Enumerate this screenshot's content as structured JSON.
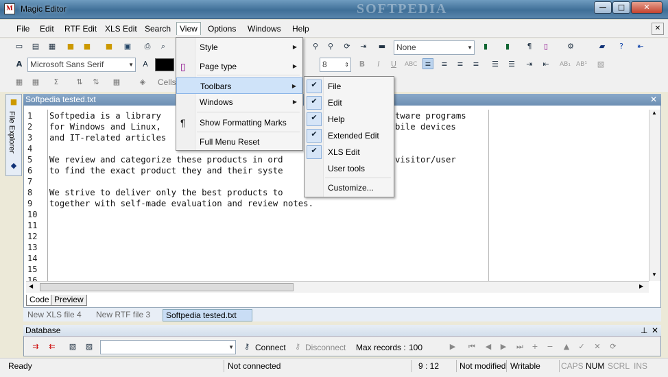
{
  "window": {
    "title": "Magic Editor",
    "watermark": "SOFTPEDIA",
    "min_btn": "—",
    "max_btn": "□",
    "close_btn": "✕"
  },
  "menubar": [
    "File",
    "Edit",
    "RTF Edit",
    "XLS Edit",
    "Search",
    "View",
    "Options",
    "Windows",
    "Help"
  ],
  "toolbar": {
    "style_combo": "None",
    "font_combo": "Microsoft Sans Serif",
    "size_combo": "8",
    "cells_label": "Cells"
  },
  "view_menu": [
    {
      "label": "Style",
      "has_sub": true,
      "icon": "",
      "highlight": false
    },
    {
      "label": "Page type",
      "has_sub": true,
      "icon": "page-icon",
      "highlight": false
    },
    {
      "label": "Toolbars",
      "has_sub": true,
      "icon": "",
      "highlight": true
    },
    {
      "label": "Windows",
      "has_sub": true,
      "icon": "",
      "highlight": false
    },
    {
      "label": "Show Formatting Marks",
      "has_sub": false,
      "icon": "pilcrow-icon",
      "highlight": false
    },
    {
      "label": "Full Menu Reset",
      "has_sub": false,
      "icon": "",
      "highlight": false
    }
  ],
  "toolbars_submenu": [
    {
      "label": "File",
      "checked": true
    },
    {
      "label": "Edit",
      "checked": true
    },
    {
      "label": "Help",
      "checked": true
    },
    {
      "label": "Extended Edit",
      "checked": true
    },
    {
      "label": "XLS Edit",
      "checked": true
    },
    {
      "label": "User tools",
      "checked": false
    },
    {
      "label": "Customize...",
      "checked": false
    }
  ],
  "sidebar": {
    "label": "File Explorer"
  },
  "document": {
    "title": "Softpedia tested.txt",
    "line_numbers": [
      "1",
      "2",
      "3",
      "4",
      "5",
      "6",
      "7",
      "8",
      "9",
      "10",
      "11",
      "12",
      "13",
      "14",
      "15",
      "16"
    ],
    "lines": [
      "Softpedia is a library",
      "for Windows and Linux,",
      "and IT-related articles",
      "",
      "We review and categorize these products in ord",
      "to find the exact product they and their syste",
      "",
      "We strive to deliver only the best products to",
      "together with self-made evaluation and review notes."
    ],
    "lines_right": [
      "tware programs",
      "bile devices",
      "",
      "",
      "visitor/user",
      "",
      "",
      "",
      ""
    ]
  },
  "bottom_tabs": [
    "Code",
    "Preview"
  ],
  "doc_tabs": [
    {
      "label": "New XLS file 4",
      "selected": false
    },
    {
      "label": "New RTF file 3",
      "selected": false
    },
    {
      "label": "Softpedia tested.txt",
      "selected": true
    }
  ],
  "database": {
    "title": "Database",
    "connect": "Connect",
    "disconnect": "Disconnect",
    "max_records_label": "Max records :",
    "max_records_value": "100"
  },
  "status": {
    "ready": "Ready",
    "connection": "Not connected",
    "position": "9 : 12",
    "modified": "Not modified",
    "mode": "Writable",
    "caps": "CAPS",
    "num": "NUM",
    "scrl": "SCRL",
    "ins": "INS"
  }
}
